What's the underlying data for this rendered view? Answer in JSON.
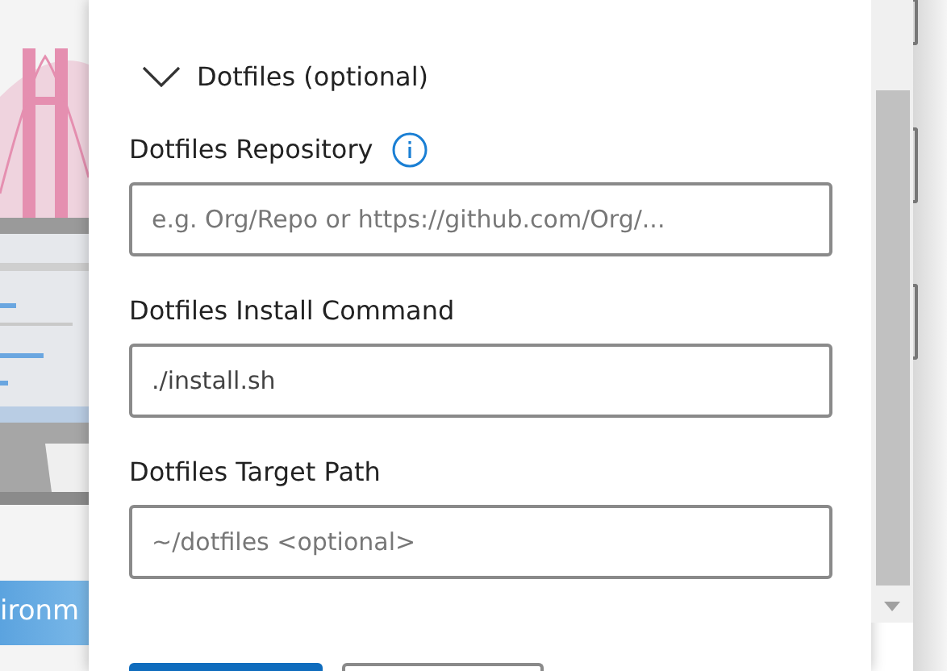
{
  "background": {
    "banner_text": "ironm"
  },
  "section": {
    "title": "Dotfiles (optional)",
    "expanded": true
  },
  "fields": [
    {
      "label": "Dotfiles Repository",
      "info": true,
      "placeholder": "e.g. Org/Repo or https://github.com/Org/..."
    },
    {
      "label": "Dotfiles Install Command",
      "info": false,
      "value": "./install.sh"
    },
    {
      "label": "Dotfiles Target Path",
      "info": false,
      "placeholder": "~/dotfiles <optional>"
    }
  ],
  "buttons": [
    {
      "kind": "primary"
    },
    {
      "kind": "secondary"
    }
  ]
}
